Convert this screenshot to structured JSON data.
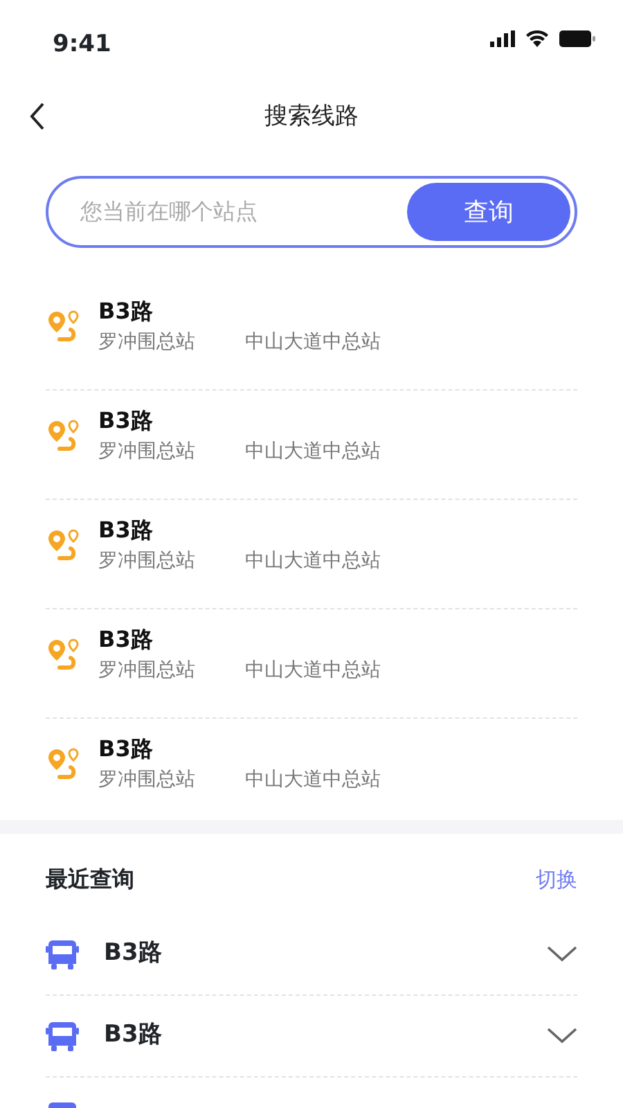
{
  "status_bar": {
    "time": "9:41"
  },
  "header": {
    "title": "搜索线路"
  },
  "search": {
    "placeholder": "您当前在哪个站点",
    "button": "查询"
  },
  "routes": [
    {
      "name": "B3路",
      "from": "罗冲围总站",
      "to": "中山大道中总站"
    },
    {
      "name": "B3路",
      "from": "罗冲围总站",
      "to": "中山大道中总站"
    },
    {
      "name": "B3路",
      "from": "罗冲围总站",
      "to": "中山大道中总站"
    },
    {
      "name": "B3路",
      "from": "罗冲围总站",
      "to": "中山大道中总站"
    },
    {
      "name": "B3路",
      "from": "罗冲围总站",
      "to": "中山大道中总站"
    }
  ],
  "recent": {
    "title": "最近查询",
    "action": "切换",
    "items": [
      {
        "name": "B3路"
      },
      {
        "name": "B3路"
      }
    ],
    "more_below": true
  }
}
